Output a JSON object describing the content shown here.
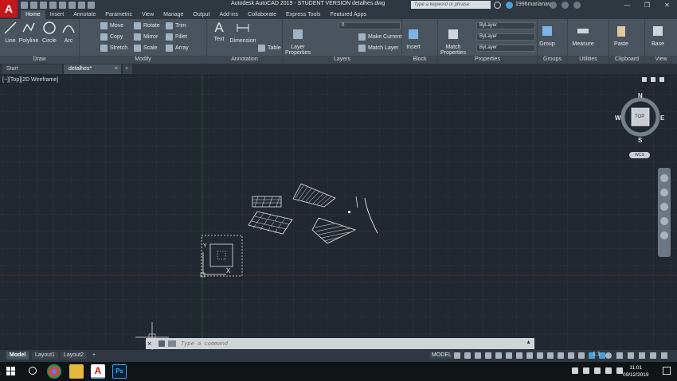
{
  "title_bar": {
    "title": "Autodesk AutoCAD 2019 - STUDENT VERSION    detalhes.dwg",
    "search_placeholder": "Type a keyword or phrase",
    "user": "1996marianav...",
    "logo": "A"
  },
  "ribbon_tabs": [
    "Home",
    "Insert",
    "Annotate",
    "Parametric",
    "View",
    "Manage",
    "Output",
    "Add-ins",
    "Collaborate",
    "Express Tools",
    "Featured Apps"
  ],
  "ribbon": {
    "draw": {
      "title": "Draw",
      "line": "Line",
      "polyline": "Polyline",
      "circle": "Circle",
      "arc": "Arc"
    },
    "modify": {
      "title": "Modify",
      "move": "Move",
      "rotate": "Rotate",
      "trim": "Trim",
      "copy": "Copy",
      "mirror": "Mirror",
      "fillet": "Fillet",
      "stretch": "Stretch",
      "scale": "Scale",
      "array": "Array"
    },
    "annotation": {
      "title": "Annotation",
      "text": "Text",
      "dimension": "Dimension",
      "table": "Table"
    },
    "layers": {
      "title": "Layers",
      "layer_properties_1": "Layer",
      "layer_properties_2": "Properties",
      "layer_value": "0",
      "make_current": "Make Current",
      "match_layer": "Match Layer"
    },
    "block": {
      "title": "Block",
      "insert": "Insert"
    },
    "properties": {
      "title": "Properties",
      "match_1": "Match",
      "match_2": "Properties",
      "bylayer_color": "ByLayer",
      "bylayer_line": "ByLayer",
      "bylayer_weight": "ByLayer"
    },
    "groups": {
      "title": "Groups",
      "group": "Group"
    },
    "utilities": {
      "title": "Utilities",
      "measure": "Measure"
    },
    "clipboard": {
      "title": "Clipboard",
      "paste": "Paste"
    },
    "view": {
      "title": "View",
      "base": "Base"
    }
  },
  "file_tabs": {
    "start": "Start",
    "current": "detalhes*",
    "close": "×",
    "add": "+"
  },
  "canvas": {
    "view_label": "[−][Top][2D Wireframe]",
    "compass": {
      "n": "N",
      "s": "S",
      "e": "E",
      "w": "W",
      "top": "TOP",
      "ucs": "WCS"
    },
    "ucs_y": "Y",
    "ucs_x": "X"
  },
  "command_line": {
    "placeholder": "Type a command",
    "close": "×"
  },
  "layout_tabs": {
    "model": "Model",
    "layout1": "Layout1",
    "layout2": "Layout2",
    "add": "+"
  },
  "status": {
    "model": "MODEL",
    "scale": "1:1"
  },
  "taskbar": {
    "time": "11:01",
    "date": "09/12/2019",
    "ps": "Ps",
    "autocad": "A"
  }
}
